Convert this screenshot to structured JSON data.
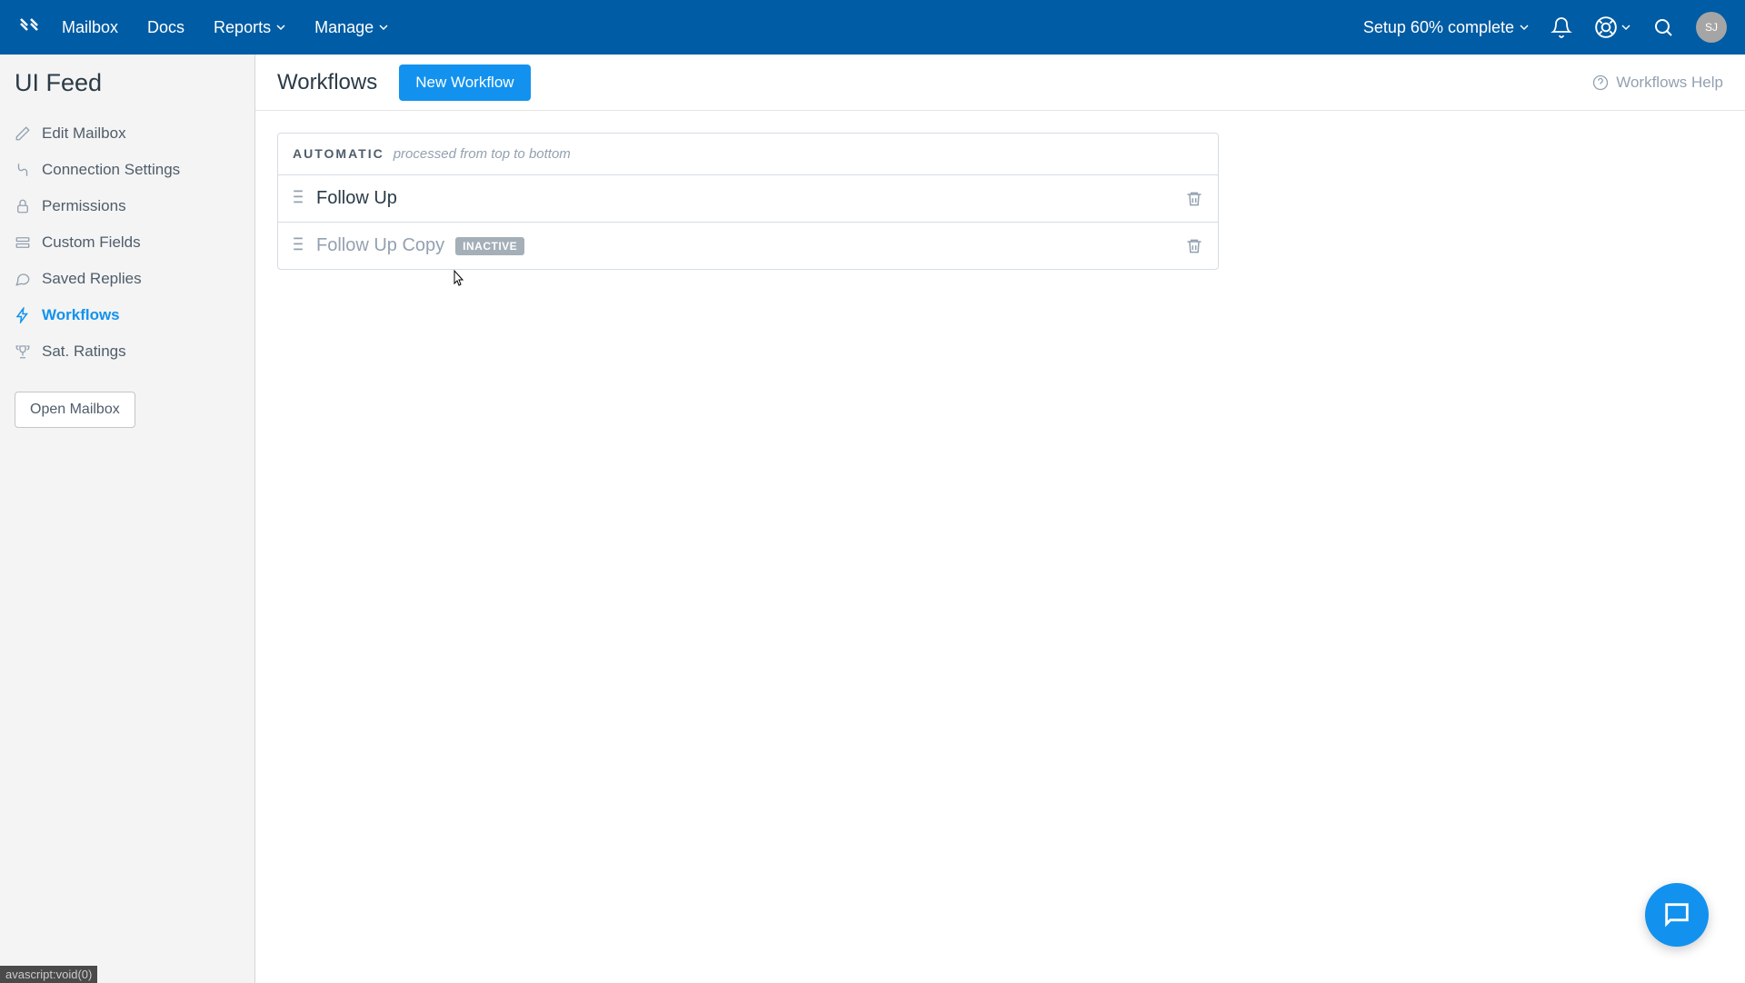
{
  "topbar": {
    "nav": {
      "mailbox": "Mailbox",
      "docs": "Docs",
      "reports": "Reports",
      "manage": "Manage"
    },
    "setup_text": "Setup 60% complete",
    "avatar_initials": "SJ"
  },
  "sidebar": {
    "title": "UI Feed",
    "items": {
      "edit_mailbox": "Edit Mailbox",
      "connection_settings": "Connection Settings",
      "permissions": "Permissions",
      "custom_fields": "Custom Fields",
      "saved_replies": "Saved Replies",
      "workflows": "Workflows",
      "sat_ratings": "Sat. Ratings"
    },
    "open_mailbox_btn": "Open Mailbox"
  },
  "page": {
    "title": "Workflows",
    "new_btn": "New Workflow",
    "help_link": "Workflows Help"
  },
  "group": {
    "label": "AUTOMATIC",
    "sub": "processed from top to bottom"
  },
  "workflows": {
    "row1_name": "Follow Up",
    "row2_name": "Follow Up Copy",
    "inactive_badge": "INACTIVE"
  },
  "status_hint": "avascript:void(0)"
}
